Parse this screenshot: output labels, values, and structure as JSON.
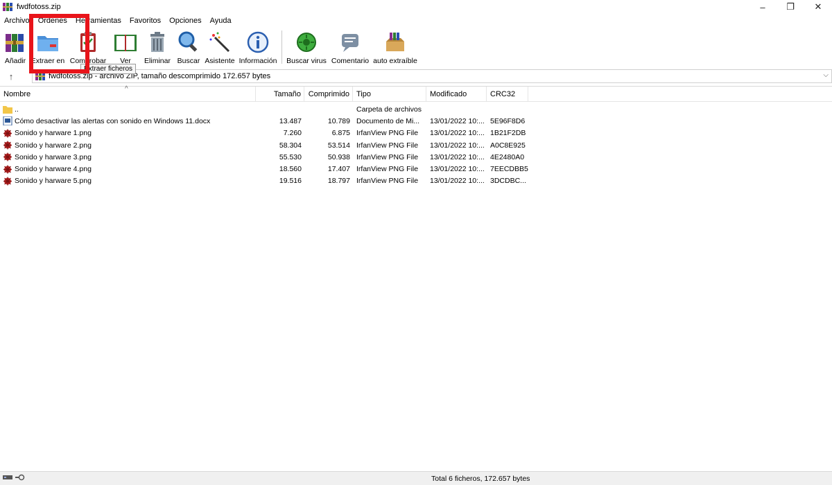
{
  "window": {
    "title": "fwdfotoss.zip",
    "controls": [
      "–",
      "❐",
      "✕"
    ]
  },
  "menu": [
    "Archivo",
    "Órdenes",
    "Herramientas",
    "Favoritos",
    "Opciones",
    "Ayuda"
  ],
  "toolbar": {
    "buttons": [
      {
        "label": "Añadir",
        "icon": "books-add-icon"
      },
      {
        "label": "Extraer en",
        "icon": "folder-extract-icon"
      },
      {
        "label": "Comprobar",
        "icon": "clipboard-check-icon"
      },
      {
        "label": "Ver",
        "icon": "open-book-icon"
      },
      {
        "label": "Eliminar",
        "icon": "trash-can-icon"
      },
      {
        "label": "Buscar",
        "icon": "magnifier-icon"
      },
      {
        "label": "Asistente",
        "icon": "magic-wand-icon"
      },
      {
        "label": "Información",
        "icon": "info-icon"
      },
      {
        "label": "Buscar virus",
        "icon": "virus-scan-icon"
      },
      {
        "label": "Comentario",
        "icon": "comment-icon"
      },
      {
        "label": "auto extraíble",
        "icon": "sfx-box-icon"
      }
    ],
    "tooltip": "Extraer ficheros"
  },
  "path": {
    "text": "fwdfotoss.zip - archivo ZIP, tamaño descomprimido 172.657 bytes"
  },
  "columns": {
    "name": "Nombre",
    "size": "Tamaño",
    "compressed": "Comprimido",
    "type": "Tipo",
    "modified": "Modificado",
    "crc": "CRC32"
  },
  "rows": [
    {
      "name": "..",
      "size": "",
      "compressed": "",
      "type": "Carpeta de archivos",
      "modified": "",
      "crc": "",
      "icon": "folder-icon"
    },
    {
      "name": "Cómo desactivar las alertas con sonido en Windows 11.docx",
      "size": "13.487",
      "compressed": "10.789",
      "type": "Documento de Mi...",
      "modified": "13/01/2022 10:...",
      "crc": "5E96F8D6",
      "icon": "word-doc-icon"
    },
    {
      "name": "Sonido y harware 1.png",
      "size": "7.260",
      "compressed": "6.875",
      "type": "IrfanView PNG File",
      "modified": "13/01/2022 10:...",
      "crc": "1B21F2DB",
      "icon": "irfanview-icon"
    },
    {
      "name": "Sonido y harware 2.png",
      "size": "58.304",
      "compressed": "53.514",
      "type": "IrfanView PNG File",
      "modified": "13/01/2022 10:...",
      "crc": "A0C8E925",
      "icon": "irfanview-icon"
    },
    {
      "name": "Sonido y harware 3.png",
      "size": "55.530",
      "compressed": "50.938",
      "type": "IrfanView PNG File",
      "modified": "13/01/2022 10:...",
      "crc": "4E2480A0",
      "icon": "irfanview-icon"
    },
    {
      "name": "Sonido y harware 4.png",
      "size": "18.560",
      "compressed": "17.407",
      "type": "IrfanView PNG File",
      "modified": "13/01/2022 10:...",
      "crc": "7EECDBB5",
      "icon": "irfanview-icon"
    },
    {
      "name": "Sonido y harware 5.png",
      "size": "19.516",
      "compressed": "18.797",
      "type": "IrfanView PNG File",
      "modified": "13/01/2022 10:...",
      "crc": "3DCDBC...",
      "icon": "irfanview-icon"
    }
  ],
  "status": {
    "text": "Total 6 ficheros, 172.657 bytes"
  },
  "colors": {
    "highlight": "#e8141a"
  }
}
